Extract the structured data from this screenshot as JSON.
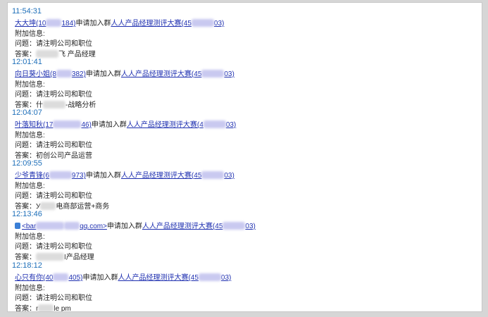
{
  "entries": [
    {
      "time": "11:54:31",
      "user_a": "大大坤(10",
      "user_b": "184)",
      "action": "申请加入群",
      "group_a": "人人产品经理测评大赛(45",
      "group_b": "03)",
      "extra_label": "附加信息:",
      "question": "问题：请注明公司和职位",
      "answer_prefix": "答案：",
      "answer_suffix": "飞 产品经理"
    },
    {
      "time": "12:01:41",
      "user_a": "向日葵小姐(8",
      "user_b": "382)",
      "action": "申请加入群",
      "group_a": "人人产品经理测评大赛(45",
      "group_b": "03)",
      "extra_label": "附加信息:",
      "question": "问题：请注明公司和职位",
      "answer_prefix": "答案：什",
      "answer_suffix": "-战略分析"
    },
    {
      "time": "12:04:07",
      "user_a": "叶落知秋(17",
      "user_b": "46)",
      "action": "申请加入群",
      "group_a": "人人产品经理测评大赛(4",
      "group_b": "03)",
      "extra_label": "附加信息:",
      "question": "问题：请注明公司和职位",
      "answer_prefix": "答案：初创公司产品运营",
      "answer_suffix": ""
    },
    {
      "time": "12:09:55",
      "user_a": "少爷青锋(6",
      "user_b": "973)",
      "action": "申请加入群",
      "group_a": "人人产品经理测评大赛(45",
      "group_b": "03)",
      "extra_label": "附加信息:",
      "question": "问题：请注明公司和职位",
      "answer_prefix": "答案：У",
      "answer_suffix": "电商部运营+商务"
    },
    {
      "time": "12:13:46",
      "user_a": "<bar",
      "user_b": "qq.com>",
      "action": "申请加入群",
      "group_a": "人人产品经理测评大赛(45",
      "group_b": "03)",
      "extra_label": "附加信息:",
      "question": "问题：请注明公司和职位",
      "answer_prefix": "答案：",
      "answer_suffix": "I产品经理"
    },
    {
      "time": "12:18:12",
      "user_a": "心只有你(40",
      "user_b": "405)",
      "action": "申请加入群",
      "group_a": "人人产品经理测评大赛(45",
      "group_b": "03)",
      "extra_label": "附加信息:",
      "question": "问题：请注明公司和职位",
      "answer_prefix": "答案：r",
      "answer_suffix": "le pm"
    }
  ]
}
